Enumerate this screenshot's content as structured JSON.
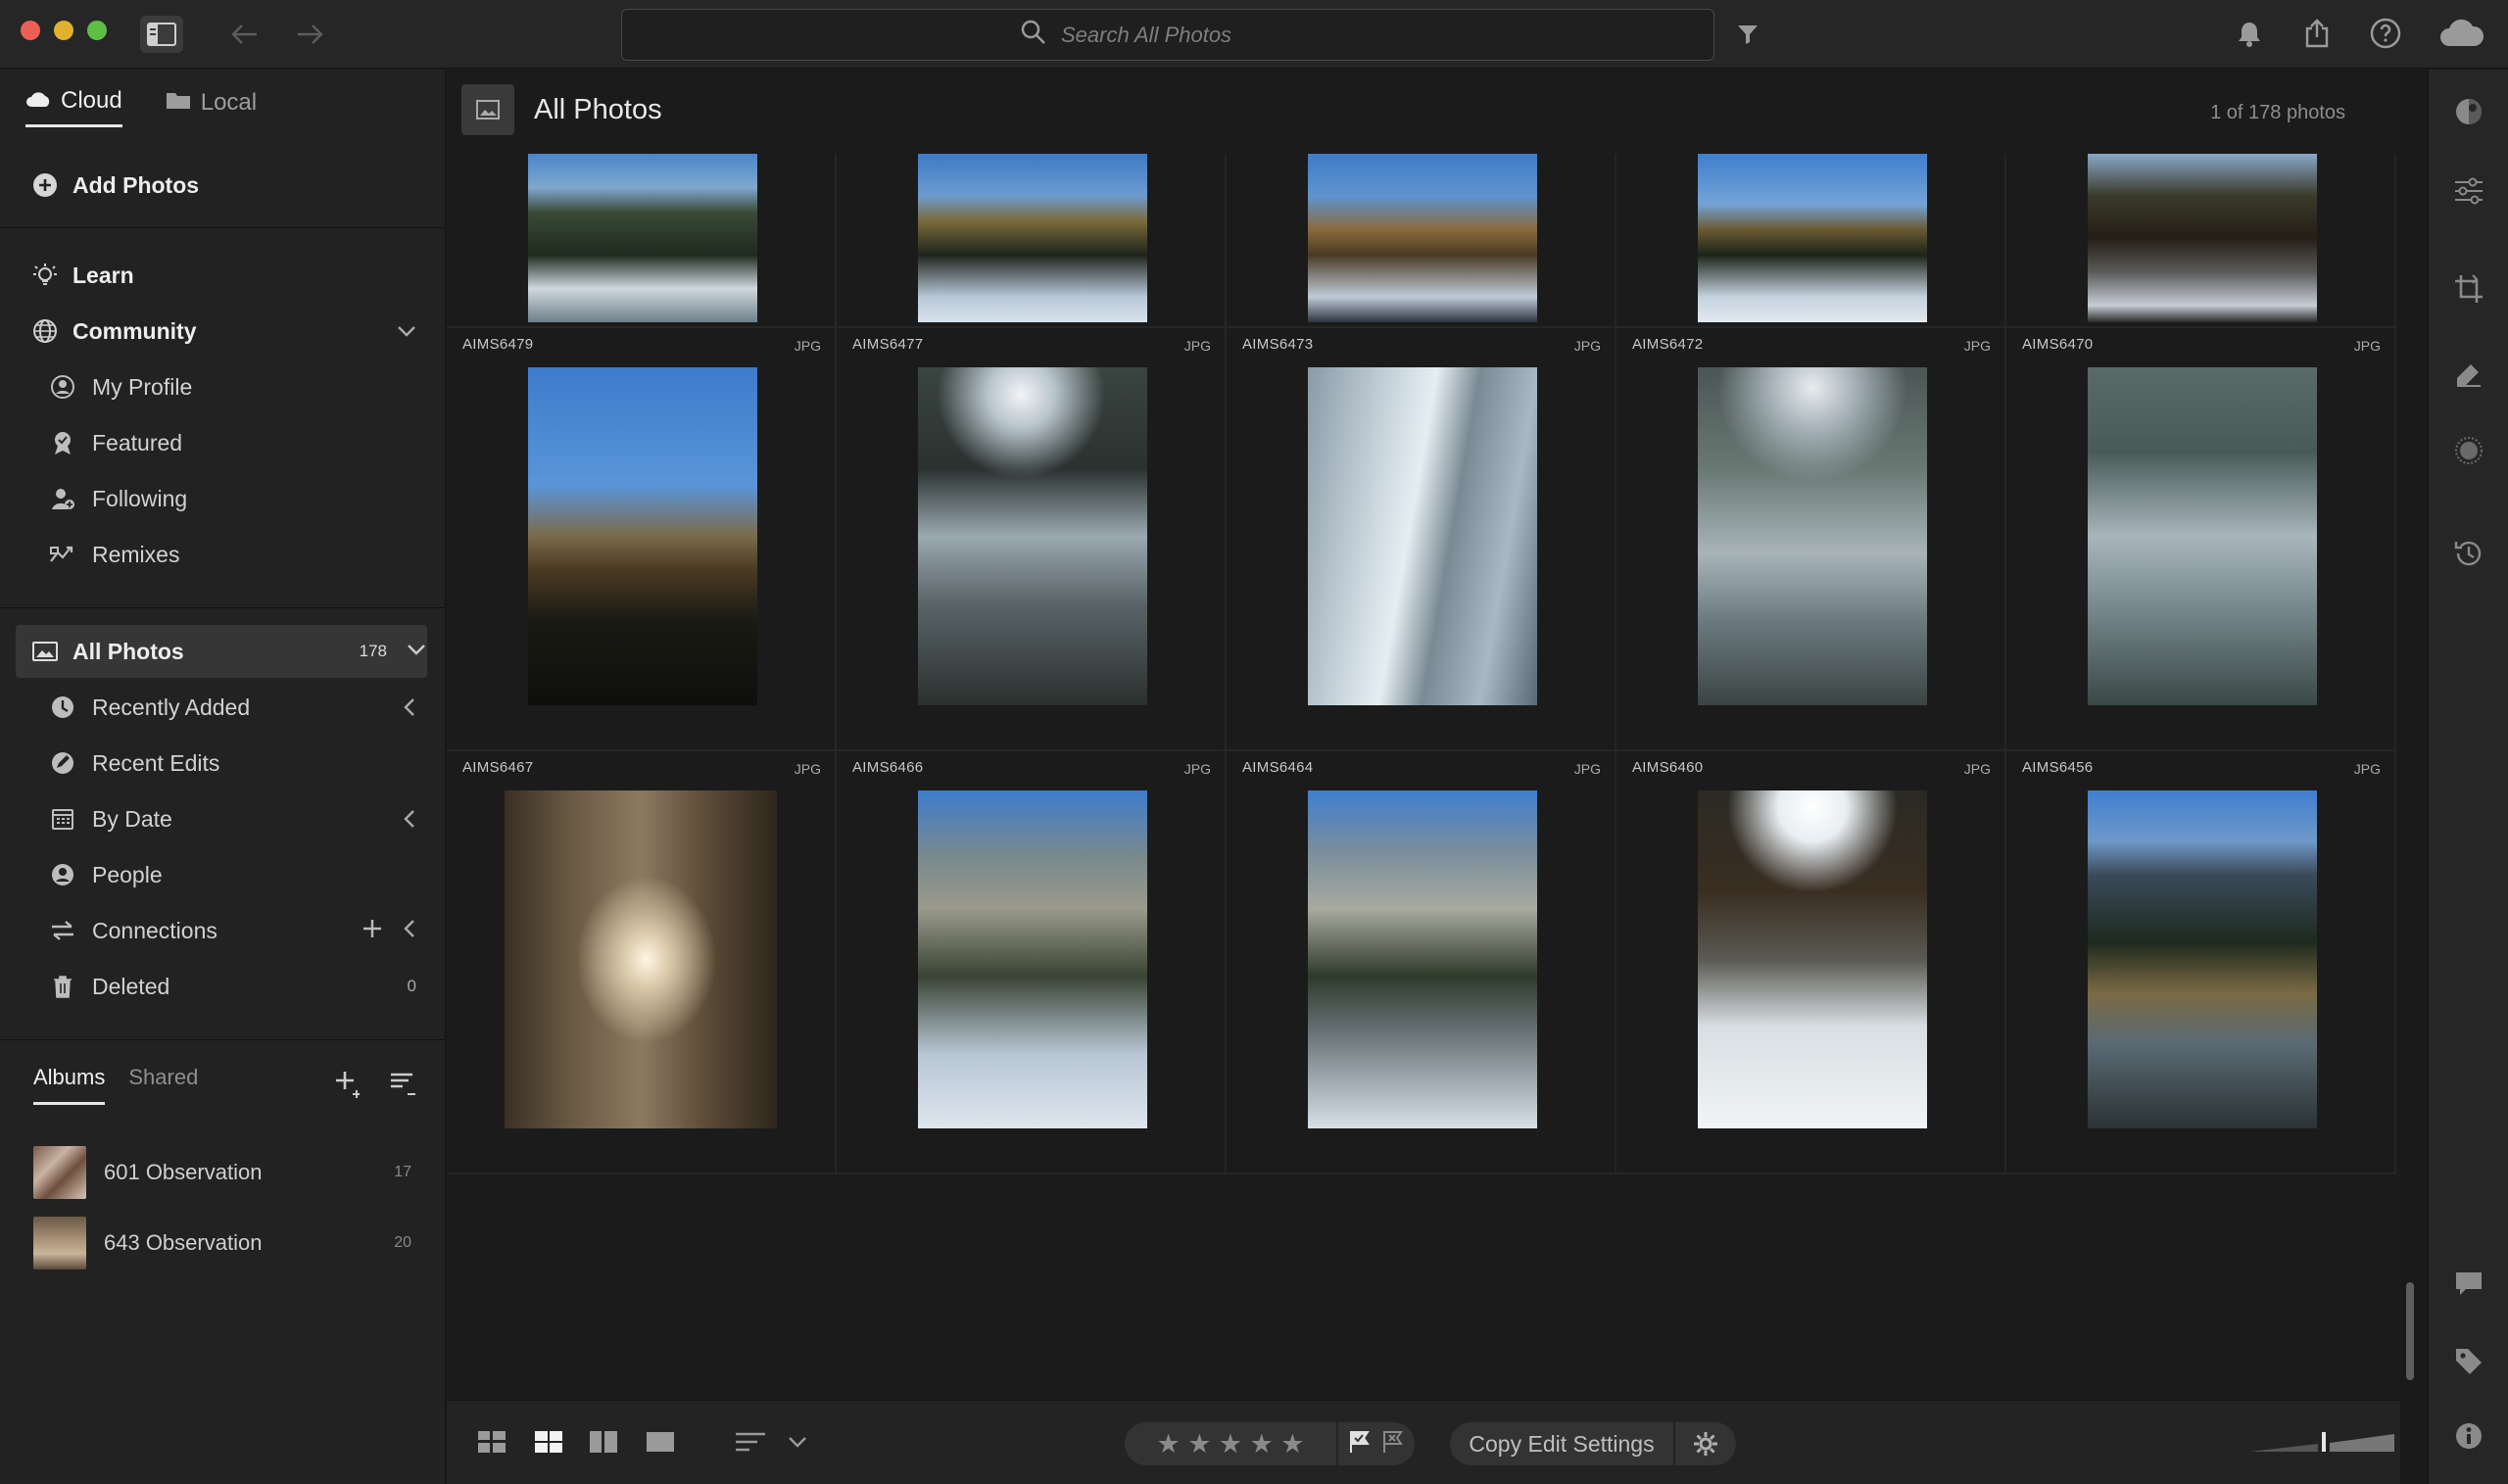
{
  "search": {
    "placeholder": "Search All Photos"
  },
  "sidebar": {
    "source_tabs": [
      {
        "label": "Cloud"
      },
      {
        "label": "Local"
      }
    ],
    "add_photos": "Add Photos",
    "learn": "Learn",
    "community": "Community",
    "community_items": [
      {
        "label": "My Profile",
        "icon": "profile-icon"
      },
      {
        "label": "Featured",
        "icon": "award-icon"
      },
      {
        "label": "Following",
        "icon": "follow-icon"
      },
      {
        "label": "Remixes",
        "icon": "remix-icon"
      }
    ],
    "all_photos": {
      "label": "All Photos",
      "count": "178"
    },
    "library_items": [
      {
        "label": "Recently Added"
      },
      {
        "label": "Recent Edits"
      },
      {
        "label": "By Date"
      },
      {
        "label": "People"
      },
      {
        "label": "Connections"
      },
      {
        "label": "Deleted",
        "count": "0"
      }
    ],
    "album_tabs": [
      {
        "label": "Albums"
      },
      {
        "label": "Shared"
      }
    ],
    "albums": [
      {
        "name": "601 Observation",
        "count": "17"
      },
      {
        "name": "643 Observation",
        "count": "20"
      }
    ]
  },
  "main": {
    "title": "All Photos",
    "photo_count": "1 of 178 photos",
    "photos_row2": [
      {
        "name": "AIMS6479",
        "type": "JPG"
      },
      {
        "name": "AIMS6477",
        "type": "JPG"
      },
      {
        "name": "AIMS6473",
        "type": "JPG"
      },
      {
        "name": "AIMS6472",
        "type": "JPG"
      },
      {
        "name": "AIMS6470",
        "type": "JPG"
      }
    ],
    "photos_row3": [
      {
        "name": "AIMS6467",
        "type": "JPG"
      },
      {
        "name": "AIMS6466",
        "type": "JPG"
      },
      {
        "name": "AIMS6464",
        "type": "JPG"
      },
      {
        "name": "AIMS6460",
        "type": "JPG"
      },
      {
        "name": "AIMS6456",
        "type": "JPG"
      }
    ]
  },
  "toolbar": {
    "stars": "★ ★ ★ ★ ★",
    "copy_edit": "Copy Edit Settings"
  },
  "colors": {
    "sky": "#3f7fcf",
    "forest": "#1f2a1f",
    "snow": "#c7d3df",
    "autumn": "#9a6a34"
  }
}
